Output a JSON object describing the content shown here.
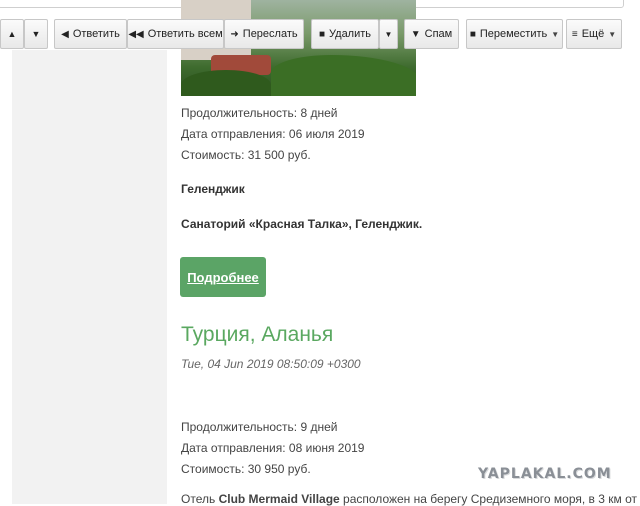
{
  "toolbar": {
    "up_arrow": "▲",
    "down_arrow": "▼",
    "reply_label": "Ответить",
    "reply_all_label": "Ответить всем",
    "forward_label": "Переслать",
    "delete_label": "Удалить",
    "spam_label": "Спам",
    "move_label": "Переместить",
    "more_label": "Ещё"
  },
  "tour1": {
    "duration": "Продолжительность: 8 дней",
    "departure": "Дата отправления: 06 июля 2019",
    "price": "Стоимость: 31 500 руб.",
    "city": "Геленджик",
    "hotel": "Санаторий «Красная Талка», Геленджик.",
    "button_label": "Подробнее"
  },
  "tour2": {
    "title": "Турция, Аланья",
    "date": "Tue, 04 Jun 2019 08:50:09 +0300",
    "duration": "Продолжительность: 9 дней",
    "departure": "Дата отправления: 08 июня 2019",
    "price": "Стоимость: 30 950 руб.",
    "desc_prefix": "Отель ",
    "hotel_name": "Club Mermaid Village",
    "desc_suffix": " расположен на берегу Средиземного моря, в 3 км от"
  },
  "watermark": "YAPLAKAL.COM",
  "colors": {
    "accent_green": "#5aa860",
    "button_green": "#5ba466",
    "sidebar_bg": "#f2f2f2"
  }
}
